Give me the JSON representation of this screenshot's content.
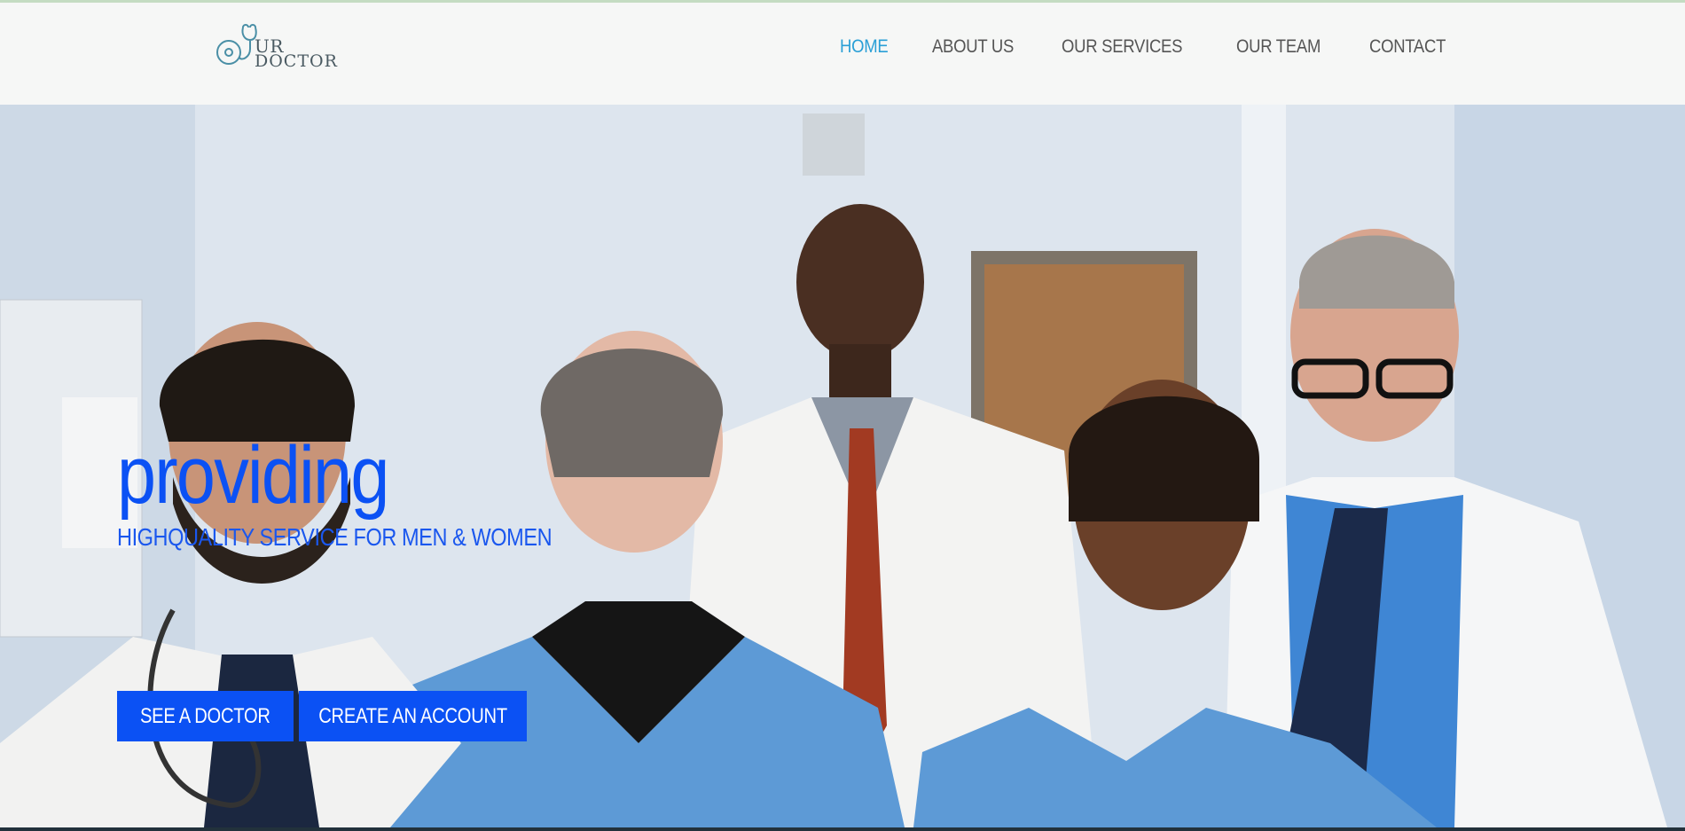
{
  "brand": {
    "logo_line1": "UR",
    "logo_line2": "DOCTOR",
    "logo_icon": "stethoscope-icon",
    "logo_color": "#4a8fa6"
  },
  "nav": {
    "items": [
      {
        "label": "HOME",
        "active": true
      },
      {
        "label": "ABOUT US",
        "active": false
      },
      {
        "label": "OUR SERVICES",
        "active": false
      },
      {
        "label": "OUR TEAM",
        "active": false
      },
      {
        "label": "CONTACT",
        "active": false
      }
    ],
    "active_color": "#2a9fd6",
    "text_color": "#555555"
  },
  "hero": {
    "title": "providing",
    "subtitle": "HIGHQUALITY SERVICE FOR MEN & WOMEN",
    "image": "group-of-doctors-photo",
    "buttons": {
      "see_doctor": "SEE A DOCTOR",
      "create_account": "CREATE AN ACCOUNT"
    },
    "accent_color": "#0b51f4"
  }
}
